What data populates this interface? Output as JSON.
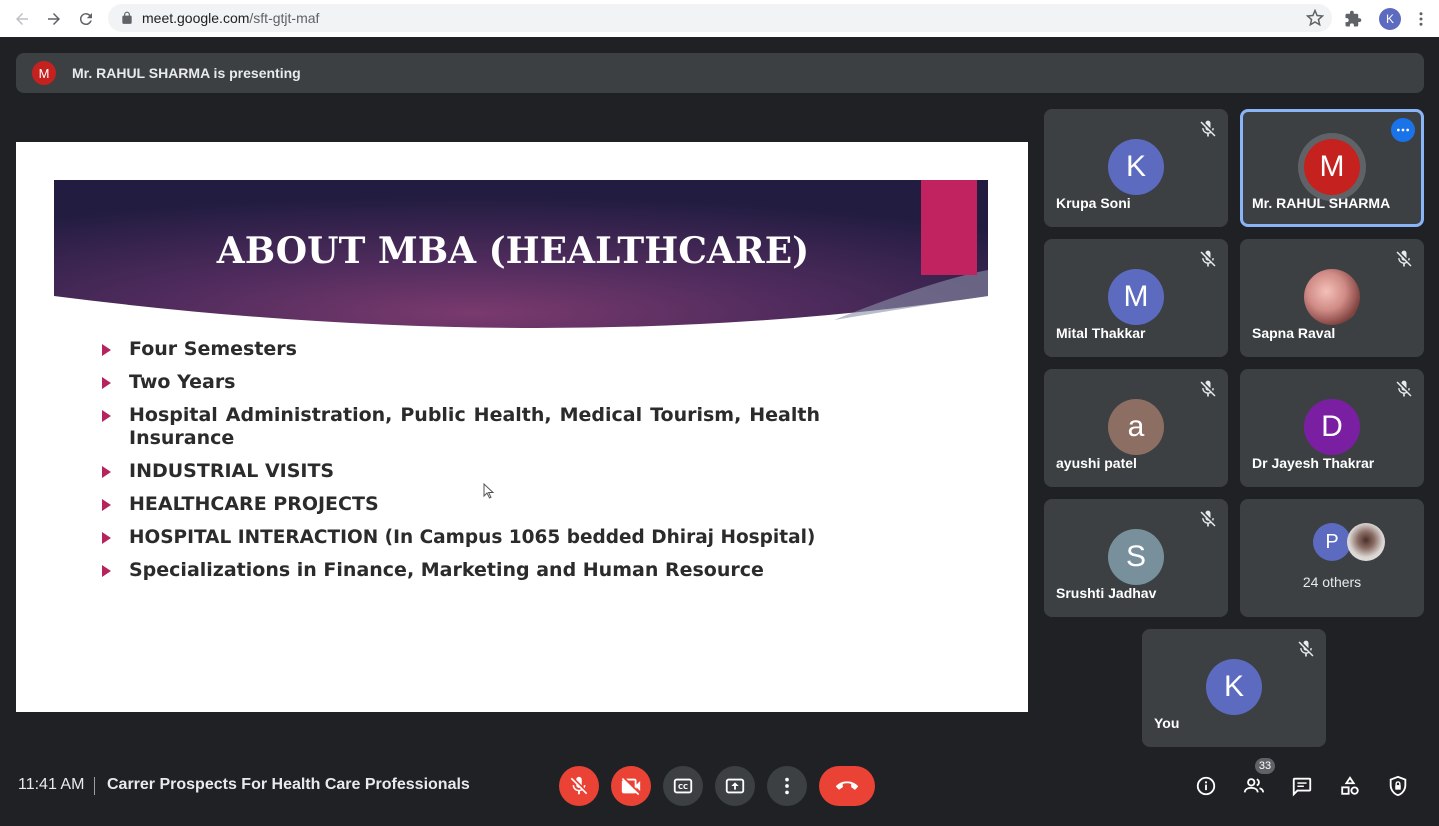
{
  "browser": {
    "url_host": "meet.google.com",
    "url_path": "/sft-gtjt-maf",
    "profile_initial": "K"
  },
  "banner": {
    "avatar_initial": "M",
    "text": "Mr. RAHUL SHARMA is presenting"
  },
  "slide": {
    "title": "ABOUT MBA (HEALTHCARE)",
    "bullets": [
      "Four Semesters",
      "Two Years",
      "Hospital Administration, Public Health, Medical Tourism, Health Insurance",
      "INDUSTRIAL VISITS",
      "HEALTHCARE PROJECTS",
      "HOSPITAL INTERACTION (In Campus 1065 bedded Dhiraj Hospital)",
      "Specializations in Finance, Marketing and Human Resource"
    ]
  },
  "participants": [
    {
      "name": "Krupa Soni",
      "initial": "K",
      "color": "#5c6bc0",
      "muted": true
    },
    {
      "name": "Mr. RAHUL SHARMA",
      "initial": "M",
      "color": "#c5221f",
      "muted": false,
      "active": true
    },
    {
      "name": "Mital Thakkar",
      "initial": "M",
      "color": "#5c6bc0",
      "muted": true
    },
    {
      "name": "Sapna Raval",
      "initial": "",
      "color": "",
      "muted": true
    },
    {
      "name": "ayushi patel",
      "initial": "a",
      "color": "#8d6e63",
      "muted": true
    },
    {
      "name": "Dr Jayesh Thakrar",
      "initial": "D",
      "color": "#7b1fa2",
      "muted": true
    },
    {
      "name": "Srushti Jadhav",
      "initial": "S",
      "color": "#78909c",
      "muted": true
    },
    {
      "name": "You",
      "initial": "K",
      "color": "#5c6bc0",
      "muted": true
    }
  ],
  "others": {
    "initial": "P",
    "color": "#5c6bc0",
    "text": "24 others"
  },
  "bottom_bar": {
    "time": "11:41 AM",
    "meeting_title": "Carrer Prospects For Health Care Professionals",
    "people_count": "33"
  },
  "icons": {
    "mic_off": "mic-off-icon",
    "cam_off": "camera-off-icon",
    "captions": "captions-icon",
    "present": "present-icon",
    "more": "more-vert-icon",
    "hangup": "call-end-icon",
    "info": "info-icon",
    "people": "people-icon",
    "chat": "chat-icon",
    "activities": "activities-icon",
    "host": "host-controls-icon"
  },
  "colors": {
    "background": "#202124",
    "tile": "#3c4043",
    "danger": "#ea4335",
    "accent": "#8ab4f8",
    "slide_accent": "#c0235f"
  }
}
